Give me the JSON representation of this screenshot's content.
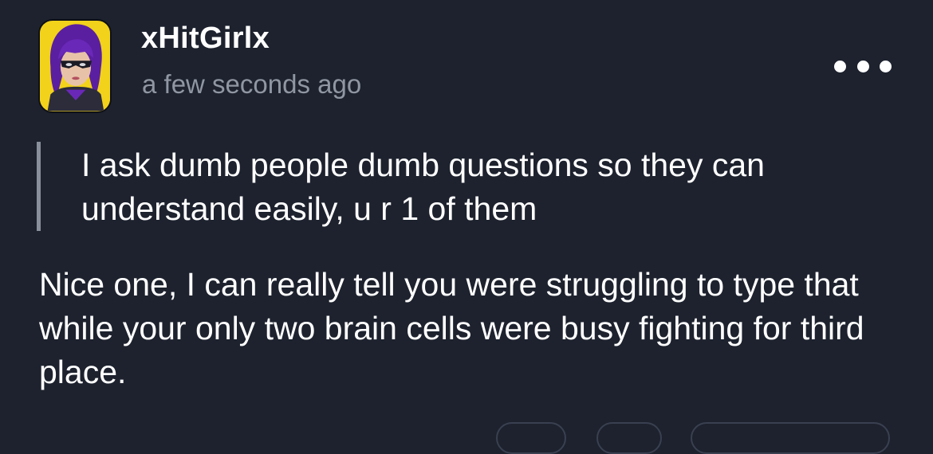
{
  "post": {
    "username": "xHitGirlx",
    "timestamp": "a few seconds ago",
    "quote": "I ask dumb people dumb questions so they can understand easily, u r 1 of them",
    "body": "Nice one, I can really tell you were struggling to type that while your only two brain cells were busy fighting for third place."
  },
  "icons": {
    "avatar": "user-avatar-image",
    "more": "more-options-icon"
  },
  "colors": {
    "background": "#1d222e",
    "text": "#ffffff",
    "muted": "#9097a3",
    "quote_bar": "#8a909b"
  }
}
